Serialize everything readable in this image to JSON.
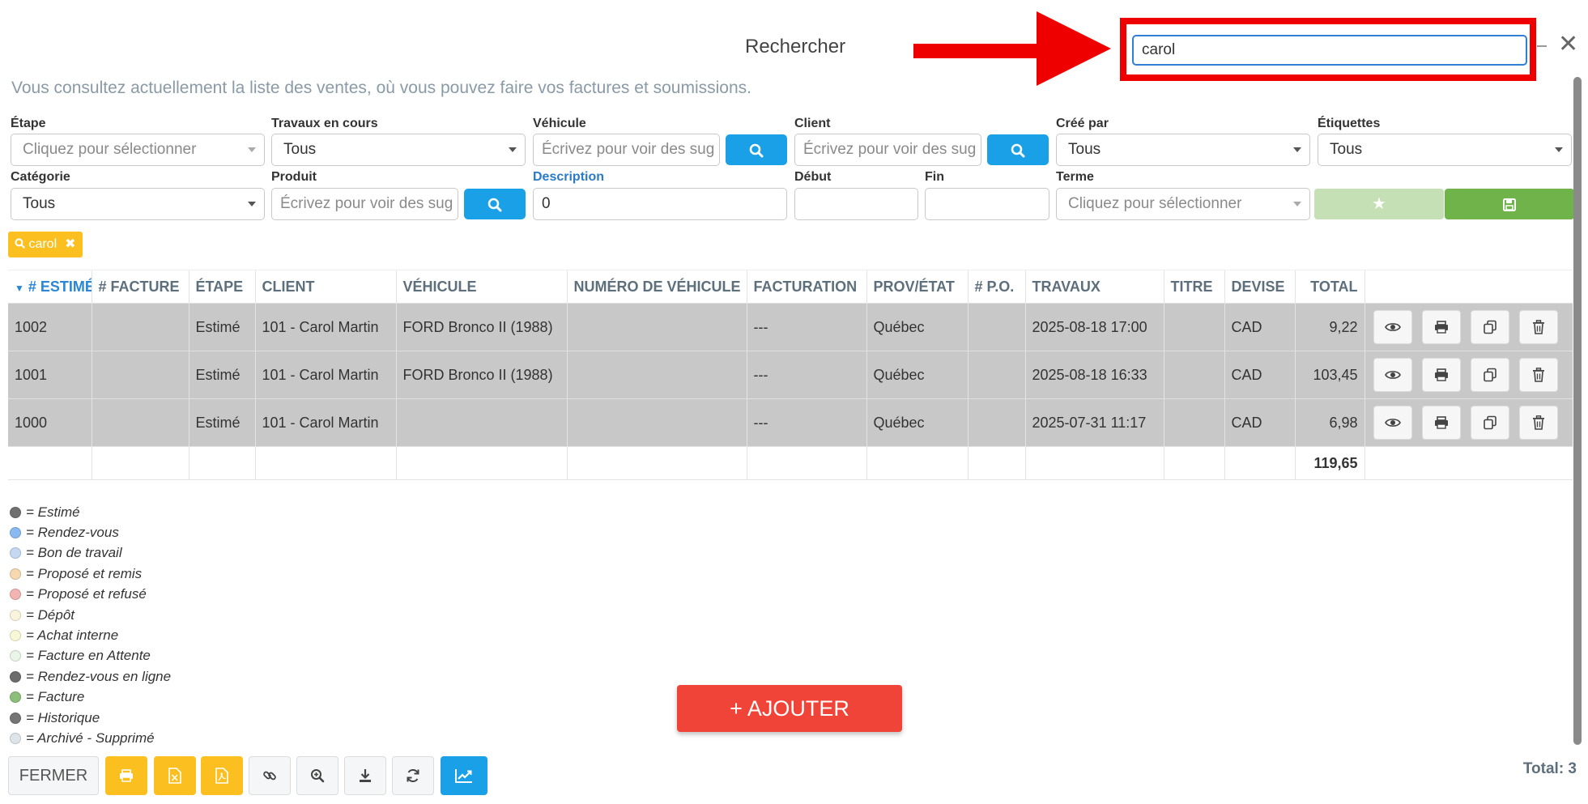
{
  "header": {
    "title": "Rechercher",
    "search_value": "carol",
    "subtitle": "Vous consultez actuellement la liste des ventes, où vous pouvez faire vos factures et soumissions."
  },
  "filters": {
    "etape": {
      "label": "Étape",
      "placeholder": "Cliquez pour sélectionner"
    },
    "travaux": {
      "label": "Travaux en cours",
      "value": "Tous"
    },
    "vehicule": {
      "label": "Véhicule",
      "placeholder": "Écrivez pour voir des sug"
    },
    "client": {
      "label": "Client",
      "placeholder": "Écrivez pour voir des sug"
    },
    "cree_par": {
      "label": "Créé par",
      "value": "Tous"
    },
    "etiquettes": {
      "label": "Étiquettes",
      "value": "Tous"
    },
    "categorie": {
      "label": "Catégorie",
      "value": "Tous"
    },
    "produit": {
      "label": "Produit",
      "placeholder": "Écrivez pour voir des sug"
    },
    "description": {
      "label": "Description",
      "value": "0"
    },
    "debut": {
      "label": "Début",
      "value": ""
    },
    "fin": {
      "label": "Fin",
      "value": ""
    },
    "terme": {
      "label": "Terme",
      "placeholder": "Cliquez pour sélectionner"
    }
  },
  "active_tag": "carol",
  "table": {
    "columns": [
      "# ESTIMÉ",
      "# FACTURE",
      "ÉTAPE",
      "CLIENT",
      "VÉHICULE",
      "NUMÉRO DE VÉHICULE",
      "FACTURATION",
      "PROV/ÉTAT",
      "# P.O.",
      "TRAVAUX",
      "TITRE",
      "DEVISE",
      "TOTAL"
    ],
    "rows": [
      {
        "estime": "1002",
        "facture": "",
        "etape": "Estimé",
        "client": "101 - Carol Martin",
        "vehicule": "FORD Bronco II (1988)",
        "numero": "",
        "facturation": "---",
        "prov": "Québec",
        "po": "",
        "travaux": "2025-08-18 17:00",
        "titre": "",
        "devise": "CAD",
        "total": "9,22"
      },
      {
        "estime": "1001",
        "facture": "",
        "etape": "Estimé",
        "client": "101 - Carol Martin",
        "vehicule": "FORD Bronco II (1988)",
        "numero": "",
        "facturation": "---",
        "prov": "Québec",
        "po": "",
        "travaux": "2025-08-18 16:33",
        "titre": "",
        "devise": "CAD",
        "total": "103,45"
      },
      {
        "estime": "1000",
        "facture": "",
        "etape": "Estimé",
        "client": "101 - Carol Martin",
        "vehicule": "",
        "numero": "",
        "facturation": "---",
        "prov": "Québec",
        "po": "",
        "travaux": "2025-07-31 11:17",
        "titre": "",
        "devise": "CAD",
        "total": "6,98"
      }
    ],
    "grand_total": "119,65"
  },
  "legend": [
    {
      "label": "= Estimé",
      "color": "#707070"
    },
    {
      "label": "= Rendez-vous",
      "color": "#8ab8f0"
    },
    {
      "label": "= Bon de travail",
      "color": "#c5d8f2"
    },
    {
      "label": "= Proposé et remis",
      "color": "#f7d8b0"
    },
    {
      "label": "= Proposé et refusé",
      "color": "#f2b3b3"
    },
    {
      "label": "= Dépôt",
      "color": "#fbf4dc"
    },
    {
      "label": "= Achat interne",
      "color": "#f8f7d6"
    },
    {
      "label": "= Facture en Attente",
      "color": "#e9f5e6"
    },
    {
      "label": "= Rendez-vous en ligne",
      "color": "#6c6c6c"
    },
    {
      "label": "= Facture",
      "color": "#8dbd7a"
    },
    {
      "label": "= Historique",
      "color": "#757575"
    },
    {
      "label": "= Archivé - Supprimé",
      "color": "#dde4ea"
    }
  ],
  "add_button": "+ AJOUTER",
  "footer": {
    "close_label": "FERMER",
    "total_count": "Total: 3"
  },
  "colors": {
    "accent_blue": "#1aa0e6",
    "add_red": "#f04438",
    "tag_yellow": "#fbbf20",
    "save_green": "#71b34b",
    "highlight_red": "#ee0000"
  }
}
